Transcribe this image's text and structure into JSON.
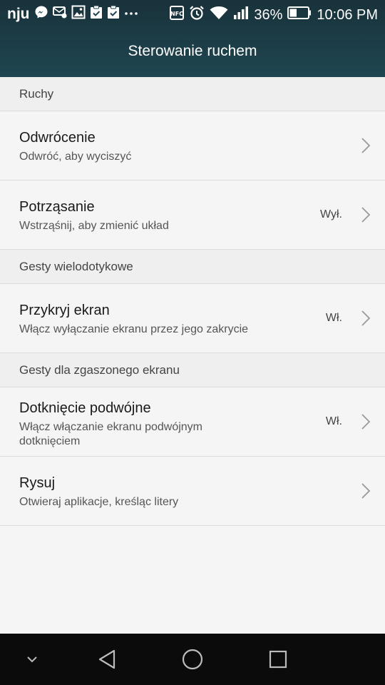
{
  "status_bar": {
    "carrier": "nju",
    "battery": "36%",
    "time": "10:06 PM",
    "icons": [
      "messenger-icon",
      "message-icon",
      "image-icon",
      "clipboard-check-icon",
      "clipboard-check-icon",
      "more-icon",
      "nfc-icon",
      "alarm-icon",
      "wifi-icon",
      "signal-icon",
      "battery-icon"
    ]
  },
  "header": {
    "title": "Sterowanie ruchem"
  },
  "sections": [
    {
      "title": "Ruchy",
      "items": [
        {
          "title": "Odwrócenie",
          "subtitle": "Odwróć, aby wyciszyć",
          "value": ""
        },
        {
          "title": "Potrząsanie",
          "subtitle": "Wstrząśnij, aby zmienić układ",
          "value": "Wył."
        }
      ]
    },
    {
      "title": "Gesty wielodotykowe",
      "items": [
        {
          "title": "Przykryj ekran",
          "subtitle": "Włącz wyłączanie ekranu przez jego zakrycie",
          "value": "Wł."
        }
      ]
    },
    {
      "title": "Gesty dla zgaszonego ekranu",
      "items": [
        {
          "title": "Dotknięcie podwójne",
          "subtitle": "Włącz włączanie ekranu podwójnym dotknięciem",
          "value": "Wł."
        },
        {
          "title": "Rysuj",
          "subtitle": "Otwieraj aplikacje, kreśląc litery",
          "value": ""
        }
      ]
    }
  ],
  "nav": [
    "hide-keyboard-icon",
    "back-icon",
    "home-icon",
    "recents-icon"
  ],
  "colors": {
    "header": "#1f4651",
    "background": "#f5f5f5",
    "navbar": "#0b0b0b"
  }
}
